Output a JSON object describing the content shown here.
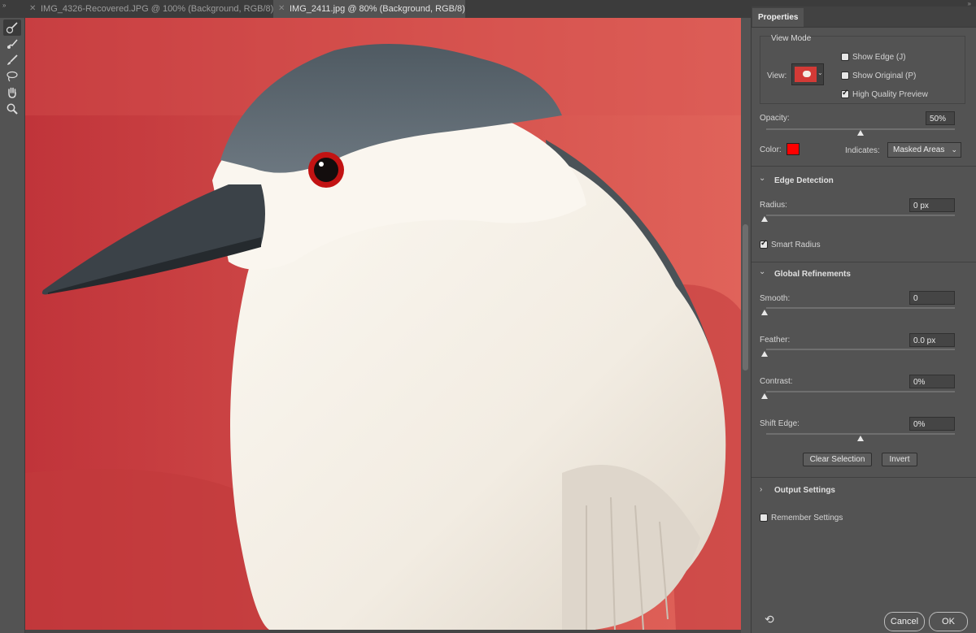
{
  "tabs": [
    {
      "label": "IMG_4326-Recovered.JPG @ 100% (Background, RGB/8) *",
      "active": false
    },
    {
      "label": "IMG_2411.jpg @ 80% (Background, RGB/8)",
      "active": true
    }
  ],
  "tools": [
    "quick-selection-brush-icon",
    "refine-edge-brush-icon",
    "brush-icon",
    "lasso-icon",
    "hand-icon",
    "zoom-icon"
  ],
  "panel": {
    "tab": "Properties",
    "view_mode": {
      "title": "View Mode",
      "view_label": "View:",
      "show_edge": {
        "label": "Show Edge (J)",
        "checked": false
      },
      "show_original": {
        "label": "Show Original (P)",
        "checked": false
      },
      "high_quality": {
        "label": "High Quality Preview",
        "checked": true
      }
    },
    "opacity": {
      "label": "Opacity:",
      "value": "50%",
      "level": 0.5
    },
    "color": {
      "label": "Color:",
      "swatch": "#ff0000"
    },
    "indicates": {
      "label": "Indicates:",
      "value": "Masked Areas"
    },
    "edge_detection": {
      "title": "Edge Detection",
      "radius": {
        "label": "Radius:",
        "value": "0 px",
        "level": 0
      },
      "smart_radius": {
        "label": "Smart Radius",
        "checked": true
      }
    },
    "global_refinements": {
      "title": "Global Refinements",
      "smooth": {
        "label": "Smooth:",
        "value": "0",
        "level": 0
      },
      "feather": {
        "label": "Feather:",
        "value": "0.0 px",
        "level": 0
      },
      "contrast": {
        "label": "Contrast:",
        "value": "0%",
        "level": 0
      },
      "shift_edge": {
        "label": "Shift Edge:",
        "value": "0%",
        "level": 0.5
      }
    },
    "clear_selection": "Clear Selection",
    "invert": "Invert",
    "output_settings": {
      "title": "Output Settings"
    },
    "remember_settings": {
      "label": "Remember Settings",
      "checked": false
    },
    "cancel": "Cancel",
    "ok": "OK"
  },
  "colors": {
    "overlay": "#c9413d",
    "panel": "#535353",
    "accent_swatch": "#ff0000"
  }
}
